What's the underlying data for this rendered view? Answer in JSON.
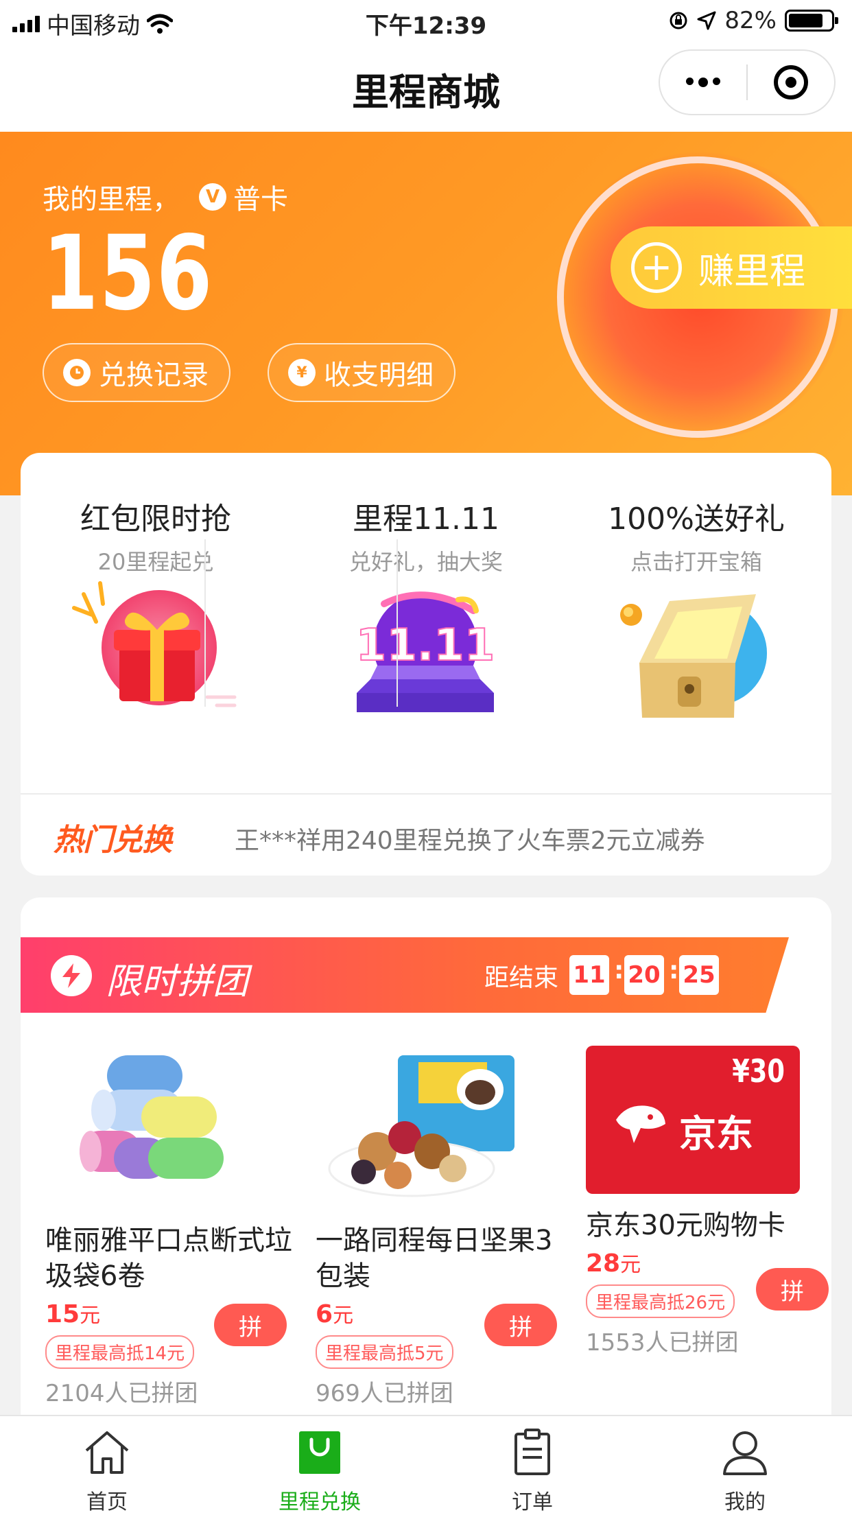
{
  "status_bar": {
    "carrier": "中国移动",
    "time": "下午12:39",
    "battery": "82%",
    "battery_level": 0.82
  },
  "nav": {
    "title": "里程商城",
    "more_icon": "more-dots-icon",
    "close_icon": "target-close-icon"
  },
  "hero": {
    "label": "我的里程，",
    "member_badge": "V",
    "member_level": "普卡",
    "mileage": "156",
    "buttons": [
      {
        "icon": "clock-icon",
        "label": "兑换记录"
      },
      {
        "icon": "yen-icon",
        "icon_text": "¥",
        "label": "收支明细"
      }
    ],
    "earn_label": "赚里程",
    "earn_icon": "plus-icon"
  },
  "promos": [
    {
      "title": "红包限时抢",
      "subtitle": "20里程起兑",
      "icon": "gift-box-icon"
    },
    {
      "title": "里程11.11",
      "subtitle": "兑好礼，抽大奖",
      "icon": "double-eleven-icon",
      "art_text": "11.11"
    },
    {
      "title": "100%送好礼",
      "subtitle": "点击打开宝箱",
      "icon": "treasure-chest-icon"
    }
  ],
  "hot": {
    "title": "热门兑换",
    "ticker": "王***祥用240里程兑换了火车票2元立减券"
  },
  "group_buy": {
    "title": "限时拼团",
    "icon": "lightning-icon",
    "countdown_label": "距结束",
    "countdown": {
      "hours": "11",
      "minutes": "20",
      "seconds": "25"
    },
    "products": [
      {
        "name": "唯丽雅平口点断式垃圾袋6卷",
        "price": "15",
        "unit": "元",
        "pin": "拼",
        "deduct": "里程最高抵14元",
        "joined": "2104人已拼团",
        "image": "trash-bag-rolls-image"
      },
      {
        "name": "一路同程每日坚果3包装",
        "price": "6",
        "unit": "元",
        "pin": "拼",
        "deduct": "里程最高抵5元",
        "joined": "969人已拼团",
        "image": "mixed-nuts-image"
      },
      {
        "name": "京东30元购物卡",
        "price": "28",
        "unit": "元",
        "pin": "拼",
        "deduct": "里程最高抵26元",
        "joined": "1553人已拼团",
        "image": "jd-gift-card-image",
        "card_value": "¥30",
        "card_brand": "京东"
      }
    ]
  },
  "tabbar": {
    "tabs": [
      {
        "label": "首页",
        "icon": "home-icon",
        "active": false
      },
      {
        "label": "里程兑换",
        "icon": "shopping-bag-icon",
        "active": true
      },
      {
        "label": "订单",
        "icon": "clipboard-icon",
        "active": false
      },
      {
        "label": "我的",
        "icon": "user-icon",
        "active": false
      }
    ]
  },
  "colors": {
    "accent_orange": "#ff9522",
    "price_red": "#ff3b3b",
    "tab_active_green": "#1aad19"
  }
}
